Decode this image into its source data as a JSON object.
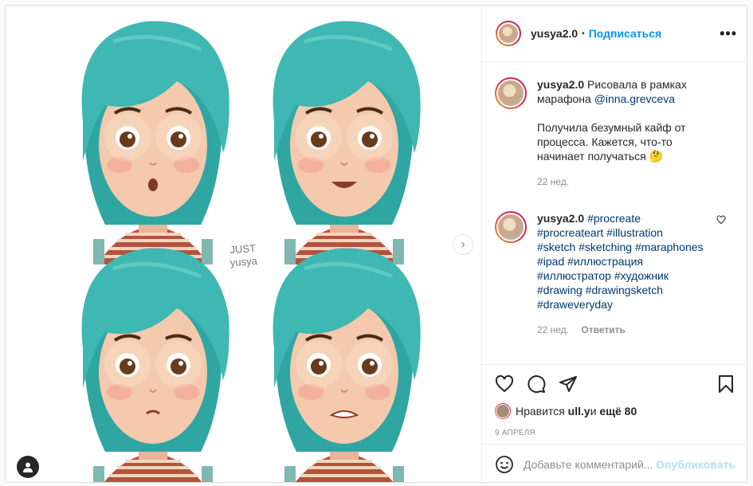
{
  "post": {
    "username": "yusya2.0",
    "follow_label": "Подписаться",
    "dot": "•",
    "more_label": "•••",
    "media": {
      "watermark_line1": "JUST",
      "watermark_line2": "yusya",
      "next_icon": "chevron-right-icon",
      "hair_color": "#3fb7b2",
      "skin_color": "#f4c9ad"
    },
    "caption": {
      "username": "yusya2.0",
      "text_before": " Рисовала в рамках марафона ",
      "mention": "@inna.grevceva",
      "text_after": "Получила безумный кайф от процесса. Кажется, что-то начинает получаться 🤔",
      "time": "22 нед."
    },
    "comment": {
      "username": "yusya2.0",
      "hashtags": "#procreate #procreateart #illustration #sketch #sketching #maraphones #ipad #иллюстрация #иллюстратор #художник #drawing #drawingsketch #draweveryday",
      "time": "22 нед.",
      "reply_label": "Ответить"
    },
    "likes": {
      "prefix": "Нравится ",
      "user": "ull.y",
      "middle": " и ",
      "rest": "ещё 80"
    },
    "date": "9 АПРЕЛЯ",
    "add_comment": {
      "placeholder": "Добавьте комментарий...",
      "post_label": "Опубликовать"
    },
    "colors": {
      "link": "#0095f6",
      "hashtag": "#00376b",
      "muted": "#8e8e8e"
    }
  }
}
